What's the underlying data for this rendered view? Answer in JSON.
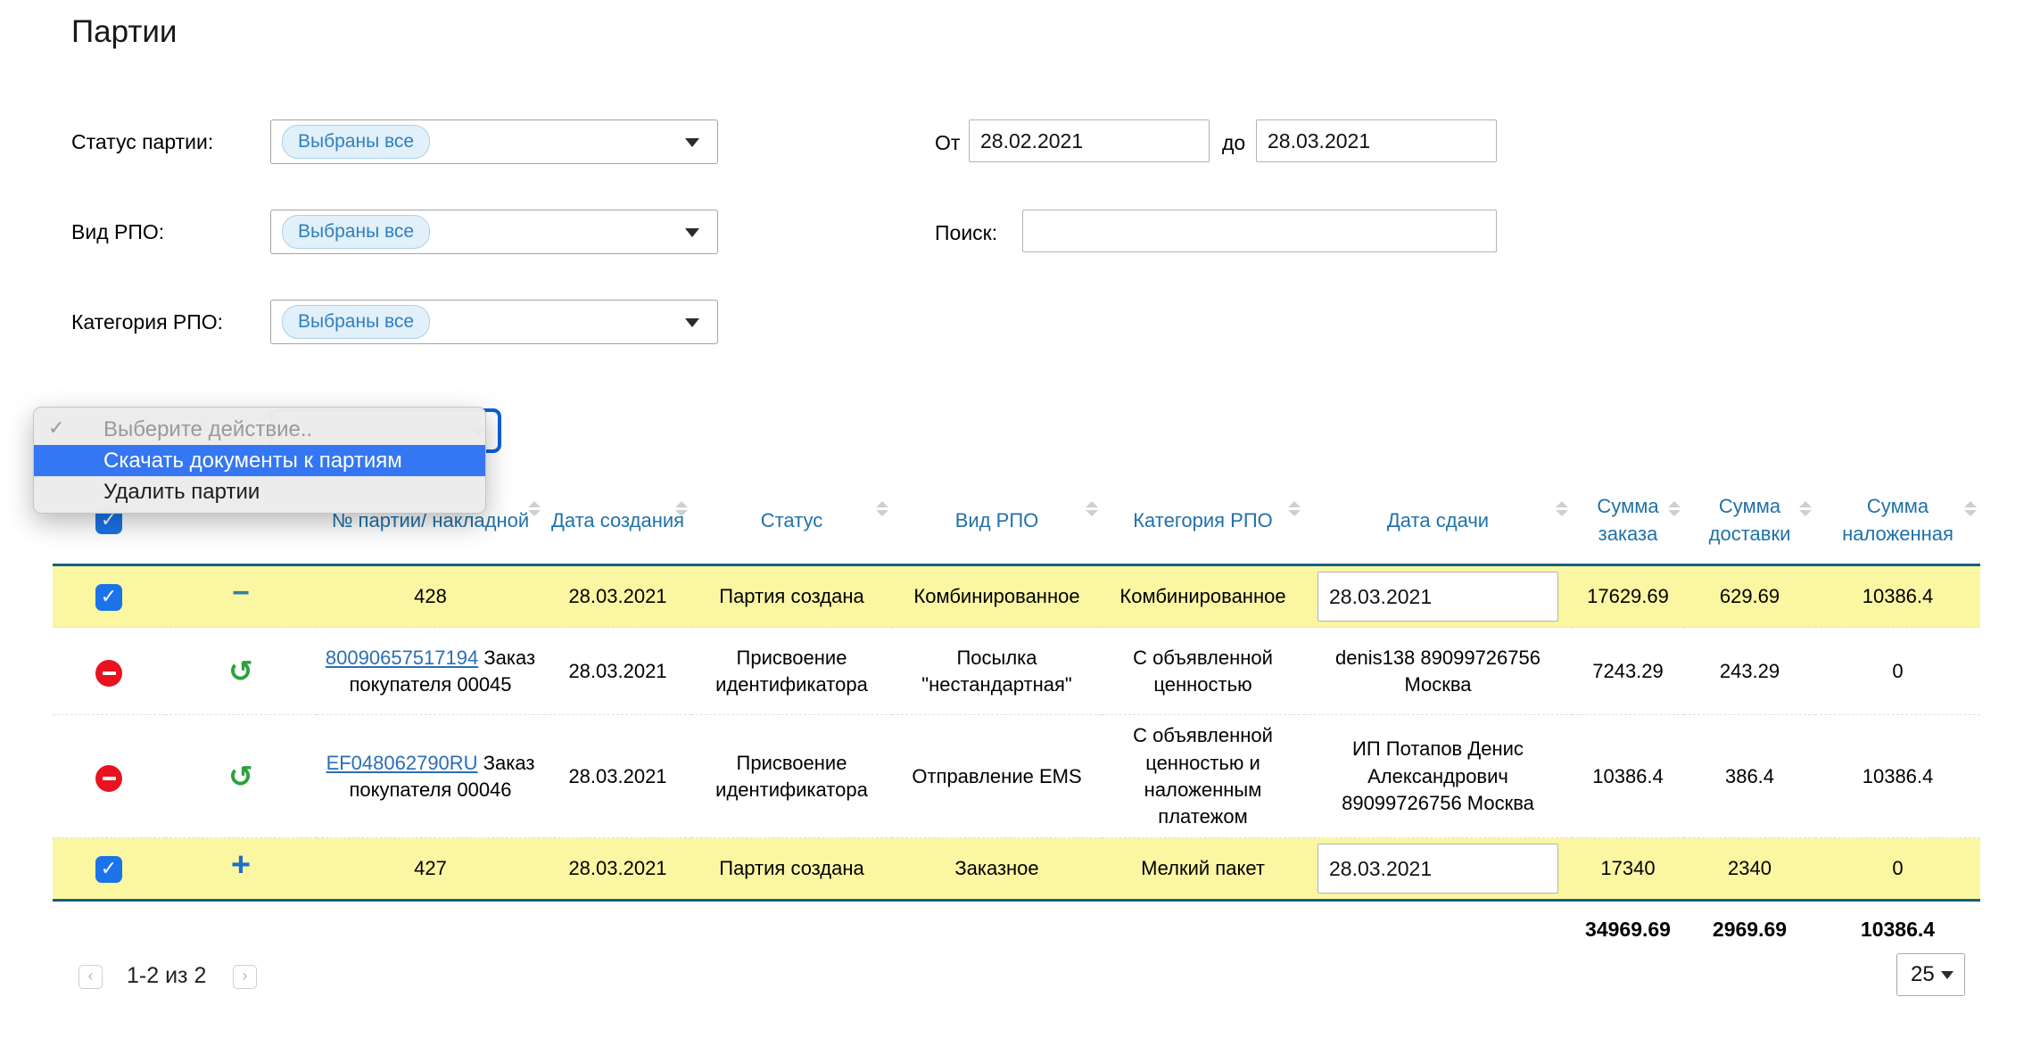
{
  "page": {
    "title": "Партии"
  },
  "colors": {
    "header_text_blue": "#2071a9",
    "table_border_teal": "#136180",
    "row_highlight_yellow": "#fbf6a2",
    "menu_selection_blue": "#3577f2",
    "focus_ring_blue": "#0b60d8",
    "checkbox_blue": "#1a73e8",
    "link_blue": "#2a6eb5",
    "danger_red": "#e8131f",
    "success_green": "#2ba23c",
    "chip_text_blue": "#2f80c0",
    "chip_bg": "#e2f0fa"
  },
  "icons": {
    "checkbox_check": "✓",
    "menu_check": "✓",
    "undo": "↺",
    "prev": "‹",
    "next": "›"
  },
  "filters": {
    "status_label": "Статус партии:",
    "rpo_type_label": "Вид РПО:",
    "rpo_category_label": "Категория РПО:",
    "selected_all_chip": "Выбраны все",
    "date_from_label": "От",
    "date_from_value": "28.02.2021",
    "date_to_label": "до",
    "date_to_value": "28.03.2021",
    "search_label": "Поиск:",
    "search_value": ""
  },
  "action_menu": {
    "items": [
      {
        "label": "Выберите действие..",
        "state": "placeholder"
      },
      {
        "label": "Скачать документы к партиям",
        "state": "selected"
      },
      {
        "label": "Удалить партии",
        "state": "normal"
      }
    ]
  },
  "table": {
    "columns": [
      {
        "label": "№ партии/ накладной",
        "sortable": true
      },
      {
        "label": "Дата создания",
        "sortable": true
      },
      {
        "label": "Статус",
        "sortable": true
      },
      {
        "label": "Вид РПО",
        "sortable": true
      },
      {
        "label": "Категория РПО",
        "sortable": true
      },
      {
        "label": "Дата сдачи",
        "sortable": true
      },
      {
        "label": "Сумма заказа",
        "sortable": true
      },
      {
        "label": "Сумма доставки",
        "sortable": true
      },
      {
        "label": "Сумма наложенная",
        "sortable": true
      }
    ],
    "rows": [
      {
        "kind": "batch",
        "checked": true,
        "expander": "collapse",
        "number": "428",
        "created": "28.03.2021",
        "status": "Партия создана",
        "rpo_type": "Комбинированное",
        "rpo_category": "Комбинированное",
        "handover_date": "28.03.2021",
        "sum_order": "17629.69",
        "sum_delivery": "629.69",
        "sum_cod": "10386.4"
      },
      {
        "kind": "shipment",
        "barcode": "80090657517194",
        "order_ref": "Заказ покупателя 00045",
        "created": "28.03.2021",
        "status": "Присвоение идентификатора",
        "rpo_type": "Посылка \"нестандартная\"",
        "rpo_category": "С объявленной ценностью",
        "recipient": "denis138 89099726756 Москва",
        "sum_order": "7243.29",
        "sum_delivery": "243.29",
        "sum_cod": "0"
      },
      {
        "kind": "shipment",
        "barcode": "EF048062790RU",
        "order_ref": "Заказ покупателя 00046",
        "created": "28.03.2021",
        "status": "Присвоение идентификатора",
        "rpo_type": "Отправление EMS",
        "rpo_category": "С объявленной ценностью и наложенным платежом",
        "recipient": "ИП Потапов Денис Александрович 89099726756 Москва",
        "sum_order": "10386.4",
        "sum_delivery": "386.4",
        "sum_cod": "10386.4"
      },
      {
        "kind": "batch",
        "checked": true,
        "expander": "expand",
        "number": "427",
        "created": "28.03.2021",
        "status": "Партия создана",
        "rpo_type": "Заказное",
        "rpo_category": "Мелкий пакет",
        "handover_date": "28.03.2021",
        "sum_order": "17340",
        "sum_delivery": "2340",
        "sum_cod": "0"
      }
    ],
    "expander_glyphs": {
      "collapse": "−",
      "expand": "+"
    },
    "totals": {
      "sum_order": "34969.69",
      "sum_delivery": "2969.69",
      "sum_cod": "10386.4"
    }
  },
  "pagination": {
    "range_text": "1-2 из 2",
    "page_size": "25"
  }
}
